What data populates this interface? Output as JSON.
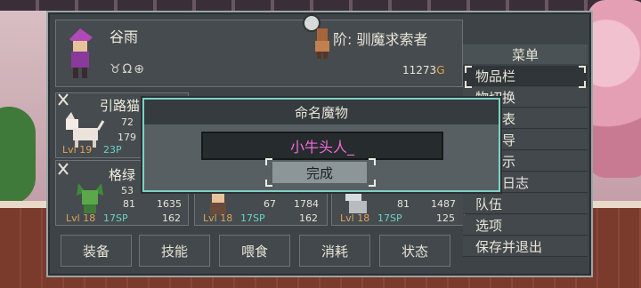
{
  "header": {
    "name": "谷雨",
    "rank_label": "阶: 驯魔求索者",
    "gold": "11273",
    "gold_suffix": "G",
    "icons": "♉Ω⊕"
  },
  "party": [
    {
      "name": "引路猫",
      "stat1": "72",
      "stat2": "179",
      "level": "Lvl 19",
      "sp": "23P"
    },
    {
      "name": "格绿",
      "stat1": "53",
      "stat2": "81",
      "stat3": "1635",
      "stat4": "162",
      "level": "Lvl 18",
      "sp": "17SP"
    },
    {
      "stat1": "67",
      "stat3": "1784",
      "stat4": "162",
      "level": "Lvl 18",
      "sp": "17SP"
    },
    {
      "stat1": "81",
      "stat3": "1487",
      "stat4": "125",
      "level": "Lvl 18",
      "sp": "17SP"
    }
  ],
  "bottom_buttons": [
    "装备",
    "技能",
    "喂食",
    "消耗",
    "状态"
  ],
  "menu": {
    "title": "菜单",
    "items": [
      "物品栏",
      "物切换",
      "物列表",
      "物引导",
      "物提示",
      "怪物日志",
      "队伍",
      "选项",
      "保存并退出"
    ],
    "selected_index": 0
  },
  "dialog": {
    "title": "命名魔物",
    "input_value": "小牛头人_",
    "confirm_label": "完成"
  },
  "colors": {
    "dialog_border": "#7fd0c6",
    "input_text": "#f06ad8",
    "level_text": "#e2a25a",
    "sp_text": "#6fd0c8"
  }
}
